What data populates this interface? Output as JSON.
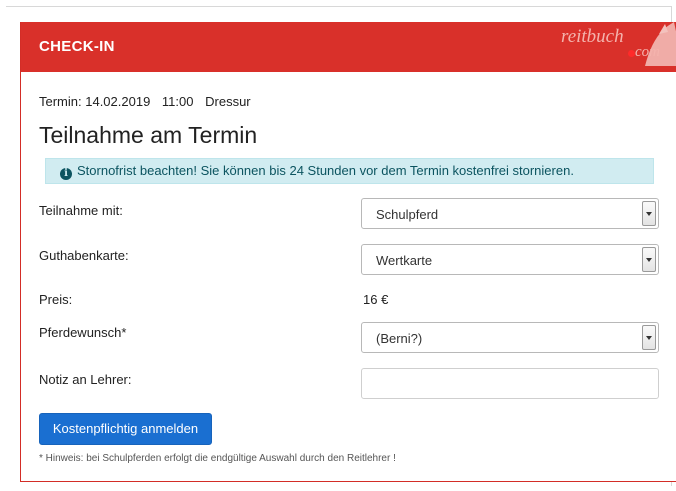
{
  "header": {
    "title": "CHECK-IN",
    "logo_line1": "reitbuch",
    "logo_line2": "com"
  },
  "appointment": {
    "termin_label": "Termin: 14.02.2019",
    "time": "11:00",
    "type": "Dressur"
  },
  "heading": "Teilnahme am Termin",
  "alert": {
    "icon": "info-icon",
    "text": "Stornofrist beachten! Sie können bis 24 Stunden vor dem Termin kostenfrei stornieren."
  },
  "form": {
    "teilnahme": {
      "label": "Teilnahme mit:",
      "value": "Schulpferd"
    },
    "guthaben": {
      "label": "Guthabenkarte:",
      "value": "Wertkarte"
    },
    "preis": {
      "label": "Preis:",
      "value": "16 €"
    },
    "pferdewunsch": {
      "label": "Pferdewunsch*",
      "value": "(Berni?)"
    },
    "notiz": {
      "label": "Notiz an Lehrer:",
      "value": ""
    }
  },
  "submit_label": "Kostenpflichtig anmelden",
  "hint": "* Hinweis: bei Schulpferden erfolgt die endgültige Auswahl durch den Reitlehrer !",
  "colors": {
    "header": "#d9302a",
    "button": "#1a6fd1",
    "alert_bg": "#d1ecf1"
  }
}
